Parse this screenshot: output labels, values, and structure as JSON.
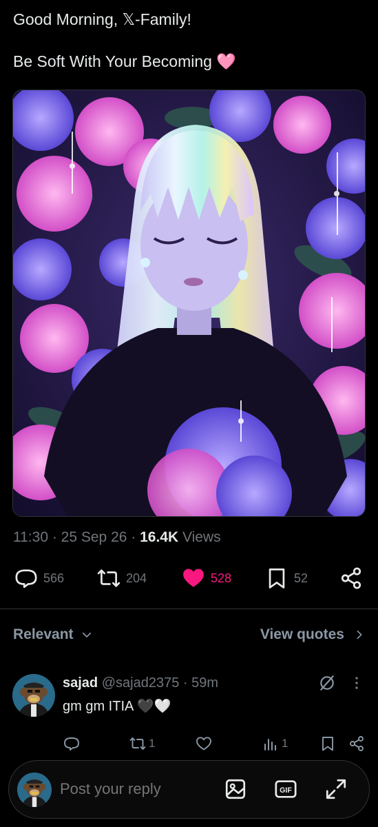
{
  "tweet": {
    "line1": "Good Morning,  𝕏-Family!",
    "line2_text": "Be Soft With Your Becoming ",
    "line2_emoji": "🩷"
  },
  "meta": {
    "time": "11:30",
    "sep1": " · ",
    "date": "25 Sep 26",
    "sep2": " · ",
    "views_count": "16.4K",
    "views_label": " Views"
  },
  "actions": {
    "replies": "566",
    "reposts": "204",
    "likes": "528",
    "bookmarks": "52"
  },
  "colors": {
    "like_accent": "#f91880",
    "muted": "#71767b",
    "divider": "#2f3336"
  },
  "sort": {
    "relevant_label": "Relevant",
    "view_quotes_label": "View quotes"
  },
  "reply": {
    "name": "sajad",
    "handle": "@sajad2375",
    "dot": " · ",
    "age": "59m",
    "text": "gm gm ITIA 🖤🤍",
    "reposts": "1",
    "views": "1"
  },
  "reply_bar": {
    "placeholder": "Post your reply"
  },
  "icons": [
    "reply-icon",
    "repost-icon",
    "heart-icon",
    "bookmark-icon",
    "share-icon",
    "chevron-down-icon",
    "chevron-right-icon",
    "grok-icon",
    "more-icon",
    "image-icon",
    "gif-icon",
    "expand-icon",
    "views-icon"
  ]
}
